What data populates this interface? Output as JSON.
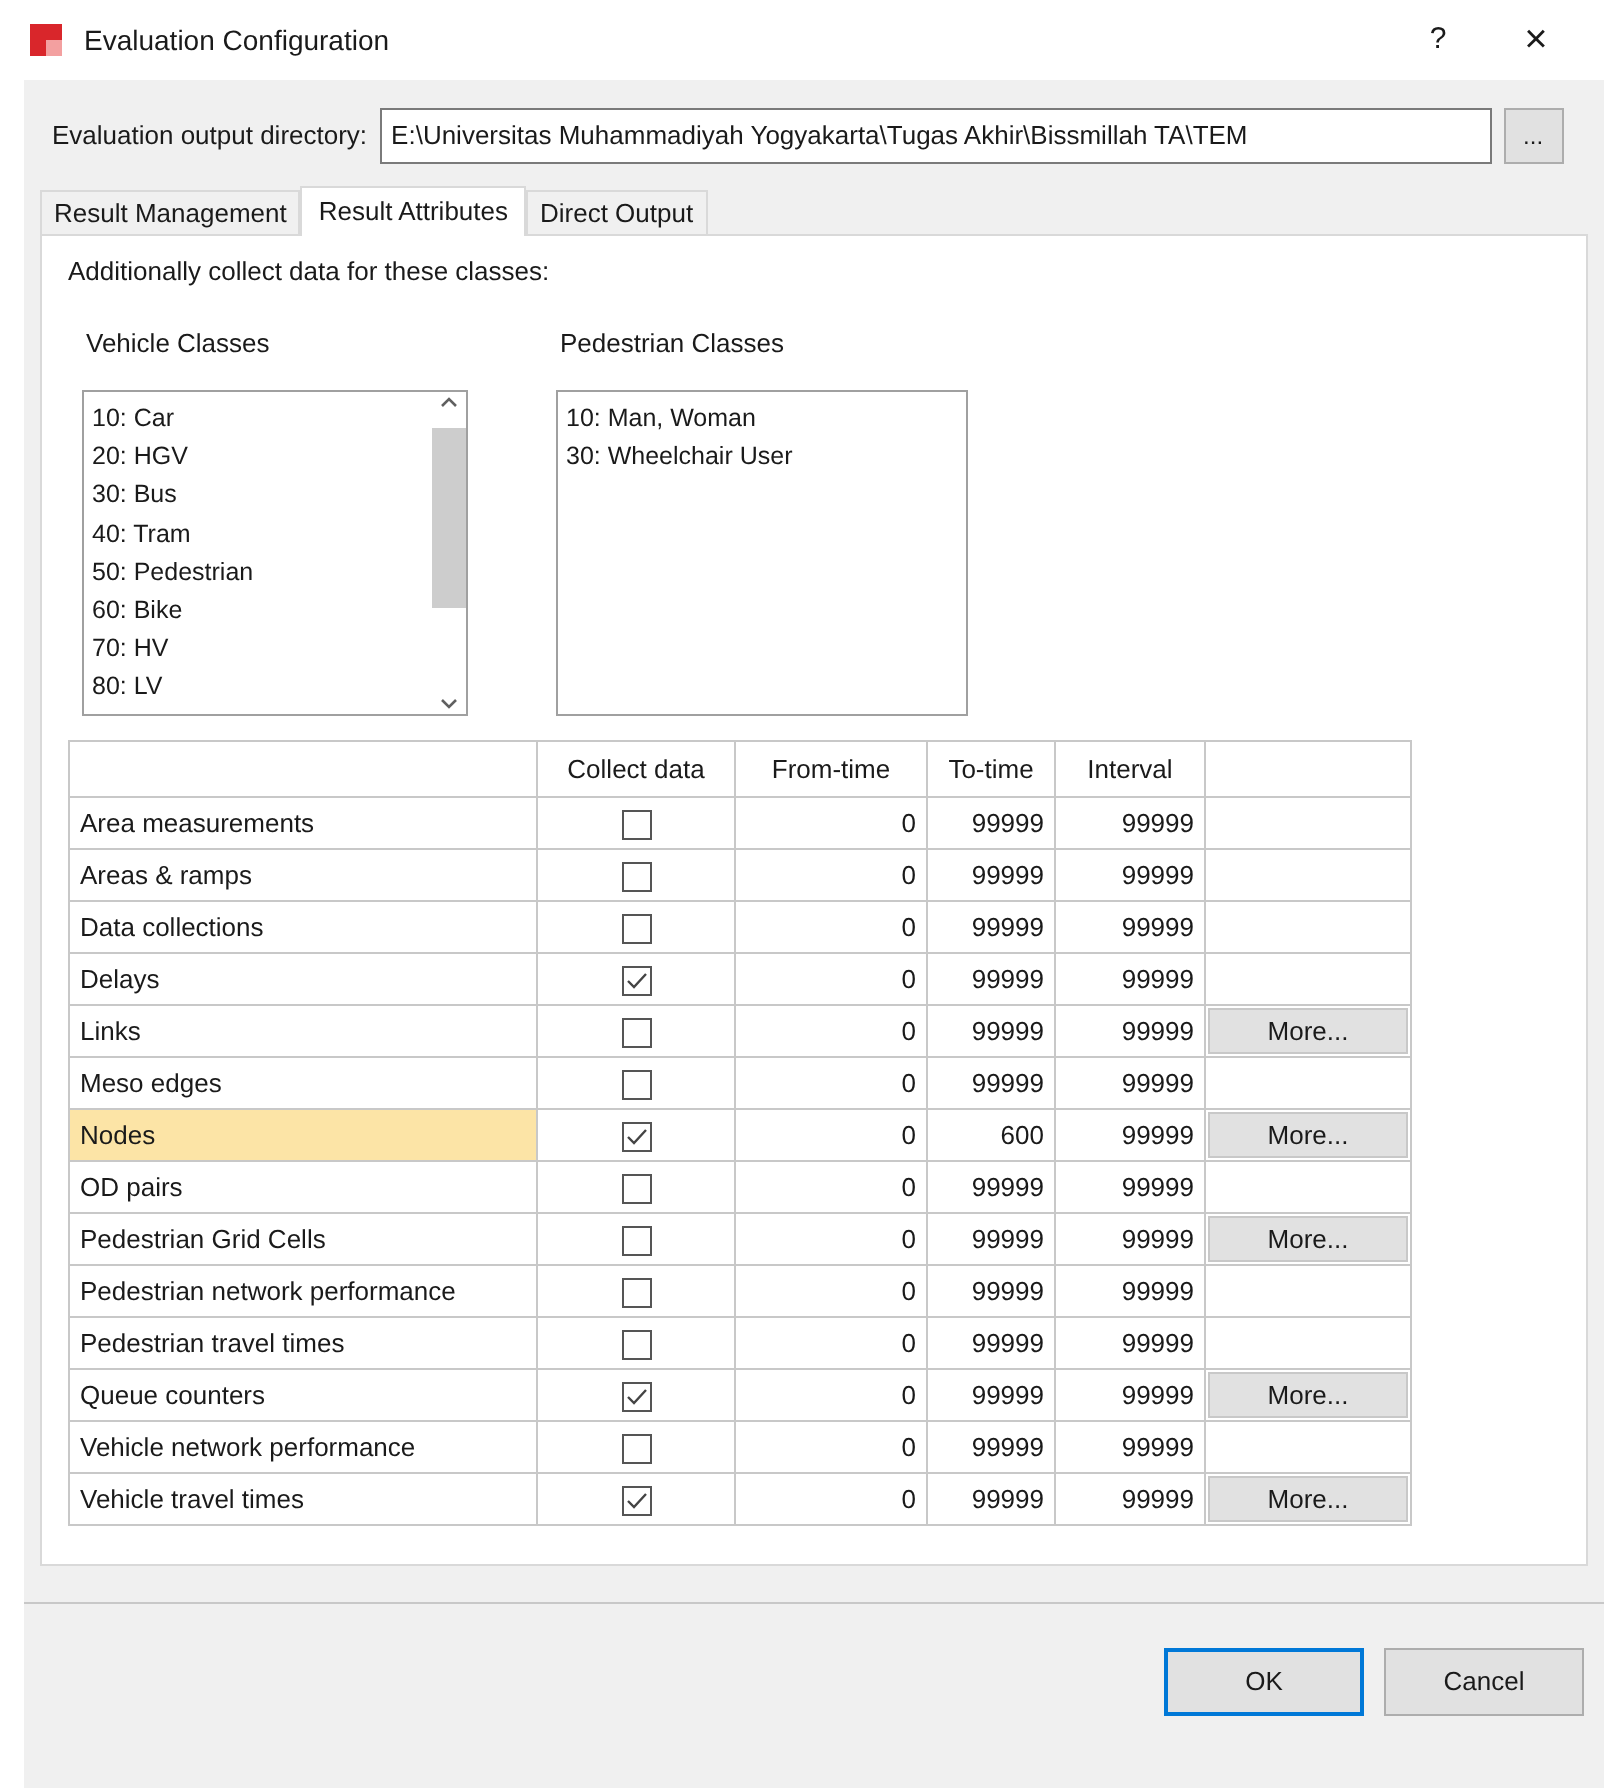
{
  "window": {
    "title": "Evaluation Configuration",
    "help": "?",
    "close": "×"
  },
  "output_directory": {
    "label": "Evaluation output directory:",
    "value": "E:\\Universitas Muhammadiyah Yogyakarta\\Tugas Akhir\\Bissmillah TA\\TEM",
    "browse": "..."
  },
  "tabs": [
    {
      "label": "Result Management",
      "selected": false
    },
    {
      "label": "Result Attributes",
      "selected": true
    },
    {
      "label": "Direct Output",
      "selected": false
    }
  ],
  "intro": "Additionally collect data for these classes:",
  "vehicle_classes": {
    "label": "Vehicle Classes",
    "items": [
      "10: Car",
      "20: HGV",
      "30: Bus",
      "40: Tram",
      "50: Pedestrian",
      "60: Bike",
      "70: HV",
      "80: LV"
    ]
  },
  "pedestrian_classes": {
    "label": "Pedestrian Classes",
    "items": [
      "10: Man, Woman",
      "30: Wheelchair User"
    ]
  },
  "table": {
    "columns": [
      "Collect data",
      "From-time",
      "To-time",
      "Interval"
    ],
    "rows": [
      {
        "name": "Area measurements",
        "checked": false,
        "from": "0",
        "to": "99999",
        "interval": "99999",
        "selected": false
      },
      {
        "name": "Areas & ramps",
        "checked": false,
        "from": "0",
        "to": "99999",
        "interval": "99999",
        "selected": false
      },
      {
        "name": "Data collections",
        "checked": false,
        "from": "0",
        "to": "99999",
        "interval": "99999",
        "selected": false
      },
      {
        "name": "Delays",
        "checked": true,
        "from": "0",
        "to": "99999",
        "interval": "99999",
        "selected": false
      },
      {
        "name": "Links",
        "checked": false,
        "from": "0",
        "to": "99999",
        "interval": "99999",
        "more": "More...",
        "selected": false
      },
      {
        "name": "Meso edges",
        "checked": false,
        "from": "0",
        "to": "99999",
        "interval": "99999",
        "selected": false
      },
      {
        "name": "Nodes",
        "checked": true,
        "from": "0",
        "to": "600",
        "interval": "99999",
        "more": "More...",
        "selected": true
      },
      {
        "name": "OD pairs",
        "checked": false,
        "from": "0",
        "to": "99999",
        "interval": "99999",
        "selected": false
      },
      {
        "name": "Pedestrian Grid Cells",
        "checked": false,
        "from": "0",
        "to": "99999",
        "interval": "99999",
        "more": "More...",
        "selected": false
      },
      {
        "name": "Pedestrian network performance",
        "checked": false,
        "from": "0",
        "to": "99999",
        "interval": "99999",
        "selected": false
      },
      {
        "name": "Pedestrian travel times",
        "checked": false,
        "from": "0",
        "to": "99999",
        "interval": "99999",
        "selected": false
      },
      {
        "name": "Queue counters",
        "checked": true,
        "from": "0",
        "to": "99999",
        "interval": "99999",
        "more": "More...",
        "selected": false
      },
      {
        "name": "Vehicle network performance",
        "checked": false,
        "from": "0",
        "to": "99999",
        "interval": "99999",
        "selected": false
      },
      {
        "name": "Vehicle travel times",
        "checked": true,
        "from": "0",
        "to": "99999",
        "interval": "99999",
        "more": "More...",
        "selected": false
      }
    ]
  },
  "buttons": [
    "OK",
    "Cancel"
  ]
}
